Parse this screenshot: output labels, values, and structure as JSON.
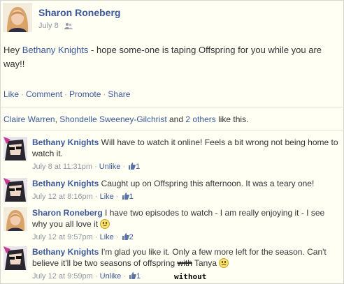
{
  "post": {
    "author": "Sharon Roneberg",
    "date": "July 8",
    "privacy_icon": "friends-icon",
    "text_prefix": "Hey ",
    "mention": "Bethany Knights",
    "text_suffix": " - hope some-one is taping Offspring for you while you are way!!"
  },
  "actions": {
    "like": "Like",
    "comment": "Comment",
    "promote": "Promote",
    "share": "Share",
    "separator": "·"
  },
  "likes": {
    "person1": "Claire Warren",
    "sep": ", ",
    "person2": "Shondelle Sweeney-Gilchrist",
    "and": " and ",
    "others": "2 others",
    "suffix": " like this."
  },
  "comments": [
    {
      "author": "Bethany Knights",
      "text": " Will have to watch it online! Feels a bit wrong not being home to watch it.",
      "time": "July 8 at 11:31pm",
      "action": "Unlike",
      "likes": "1"
    },
    {
      "author": "Bethany Knights",
      "text": " Caught up on Offspring this afternoon. It was a teary one!",
      "time": "July 12 at 8:16pm",
      "action": "Like",
      "likes": "1"
    },
    {
      "author": "Sharon Roneberg",
      "text": " I have two episodes to watch - I am really enjoying it - I see why you all love it ",
      "time": "July 12 at 9:57pm",
      "action": "Like",
      "likes": "2"
    },
    {
      "author": "Bethany Knights",
      "text_a": " I'm glad you like it. Only a few more left for the season. Can't believe it'll be two seasons of offspring ",
      "struck": "with",
      "text_b": " Tanya ",
      "time": "July 12 at 9:59pm",
      "action": "Unlike",
      "likes": "1"
    }
  ],
  "annotation": "without",
  "colors": {
    "link": "#3b5998",
    "background": "#fffff4",
    "meta": "#9197a3"
  }
}
